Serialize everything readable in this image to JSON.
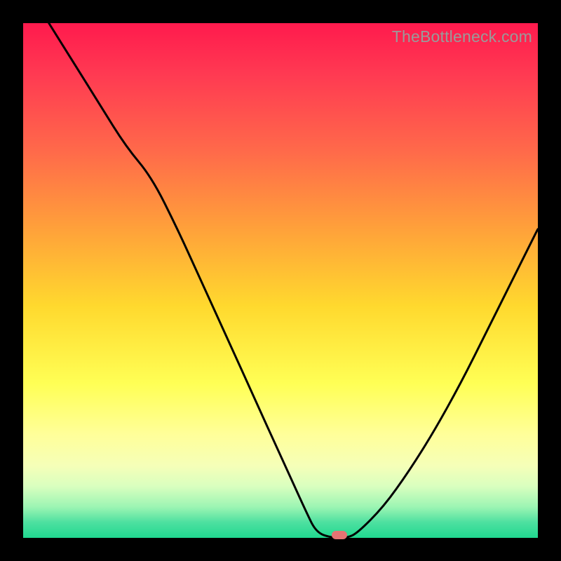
{
  "attribution": "TheBottleneck.com",
  "colors": {
    "gradient_top": "#ff1a4d",
    "gradient_mid": "#ffd92e",
    "gradient_bottom": "#20d890",
    "curve": "#000000",
    "marker": "#e57373",
    "frame": "#000000",
    "attribution_text": "#9a9a9a"
  },
  "chart_data": {
    "type": "line",
    "title": "",
    "xlabel": "",
    "ylabel": "",
    "xlim": [
      0,
      100
    ],
    "ylim": [
      0,
      100
    ],
    "grid": false,
    "legend": false,
    "series": [
      {
        "name": "bottleneck-curve",
        "x": [
          5,
          10,
          15,
          20,
          25,
          30,
          35,
          40,
          45,
          50,
          55,
          57,
          60,
          63,
          65,
          70,
          75,
          80,
          85,
          90,
          95,
          100
        ],
        "y": [
          100,
          92,
          84,
          76,
          70,
          60,
          49,
          38,
          27,
          16,
          5,
          1,
          0,
          0,
          1,
          6,
          13,
          21,
          30,
          40,
          50,
          60
        ]
      }
    ],
    "marker": {
      "x": 61.5,
      "y": 0
    },
    "note": "V-shaped curve descending from top-left, flat minimum near x≈60, rising toward right; background vertical gradient red→orange→yellow→green; single salmon pill marker at curve minimum on baseline."
  }
}
